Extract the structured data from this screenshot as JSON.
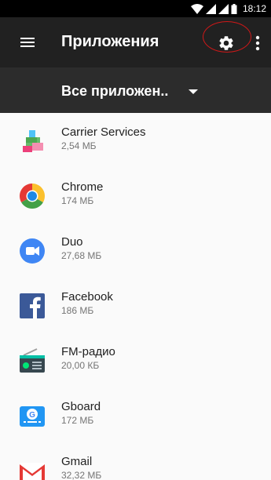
{
  "status_bar": {
    "time": "18:12"
  },
  "toolbar": {
    "title": "Приложения"
  },
  "filter": {
    "label": "Все приложен.."
  },
  "apps": [
    {
      "name": "Carrier Services",
      "size": "2,54 МБ",
      "icon": "carrier-services-icon"
    },
    {
      "name": "Chrome",
      "size": "174 МБ",
      "icon": "chrome-icon"
    },
    {
      "name": "Duo",
      "size": "27,68 МБ",
      "icon": "duo-icon"
    },
    {
      "name": "Facebook",
      "size": "186 МБ",
      "icon": "facebook-icon"
    },
    {
      "name": "FM-радио",
      "size": "20,00 КБ",
      "icon": "fm-radio-icon"
    },
    {
      "name": "Gboard",
      "size": "172 МБ",
      "icon": "gboard-icon"
    },
    {
      "name": "Gmail",
      "size": "32,32 МБ",
      "icon": "gmail-icon"
    }
  ],
  "colors": {
    "toolbar_bg": "#212121",
    "filter_bg": "#2c2c2c",
    "highlight": "#d01818",
    "list_bg": "#fafafa"
  }
}
